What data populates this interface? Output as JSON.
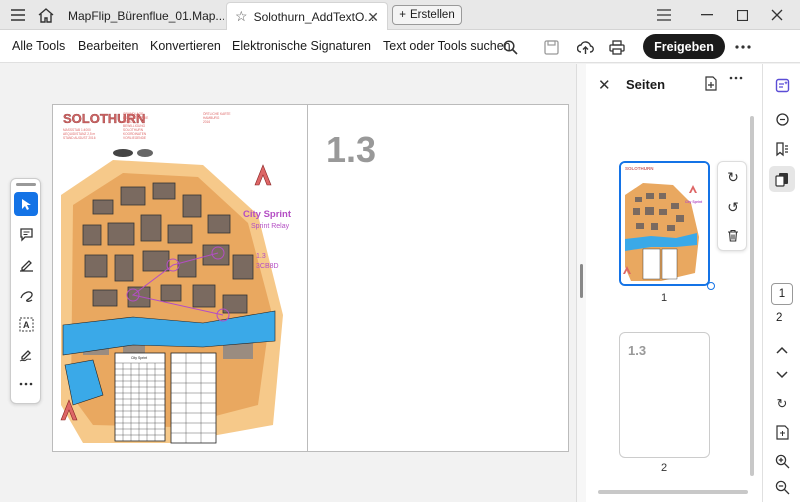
{
  "tabs": {
    "inactive": {
      "label": "MapFlip_Bürenflue_01.Map..."
    },
    "active": {
      "label": "Solothurn_AddTextO..."
    },
    "new_label": "Erstellen"
  },
  "menu": {
    "all_tools": "Alle Tools",
    "edit": "Bearbeiten",
    "convert": "Konvertieren",
    "esign": "Elektronische Signaturen",
    "search": "Text oder Tools suchen",
    "share": "Freigeben"
  },
  "document": {
    "page2_label": "1.3",
    "map": {
      "title": "SOLOTHURN",
      "city_sprint": "City Sprint",
      "sprint_relay": "Sprint Relay",
      "course": "1.3",
      "code": "3CB8D",
      "table_title": "City Sprint"
    }
  },
  "pages_panel": {
    "title": "Seiten",
    "thumb1_number": "1",
    "thumb2_number": "2",
    "thumb2_label": "1.3"
  },
  "rail": {
    "current_page": "1",
    "total_pages": "2"
  },
  "colors": {
    "accent": "#1473e6",
    "share_bg": "#1b1b1b",
    "map_water": "#3aa9e8",
    "map_course": "#b44ec4"
  }
}
